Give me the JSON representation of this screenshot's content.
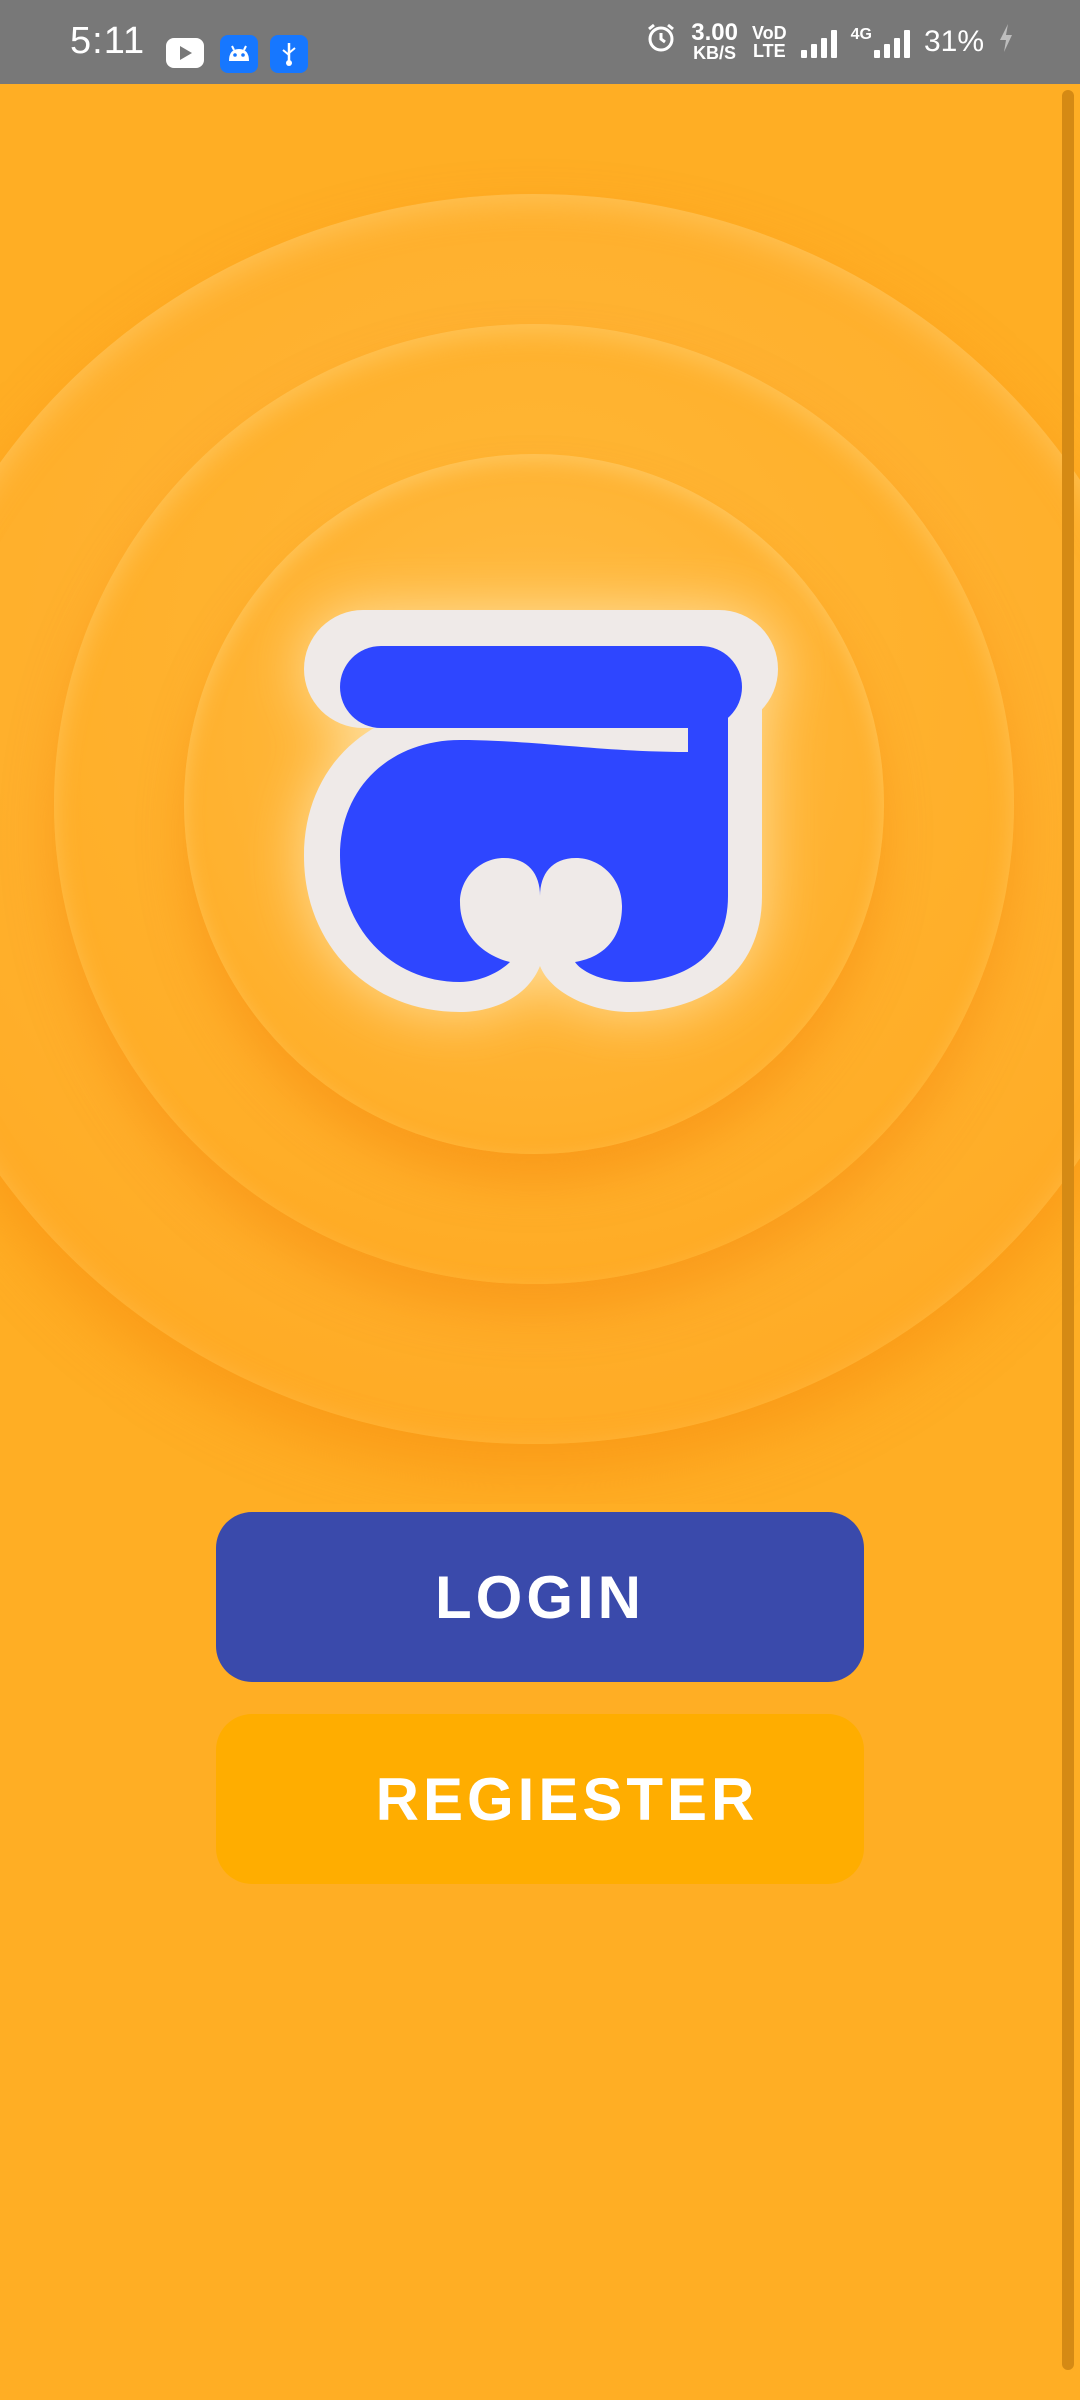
{
  "status_bar": {
    "time": "5:11",
    "speed_value": "3.00",
    "speed_unit": "KB/S",
    "volte_top": "VoD",
    "volte_bottom": "LTE",
    "network_type": "4G",
    "battery": "31%",
    "icons": [
      "youtube-icon",
      "android-icon",
      "usb-icon",
      "alarm-icon",
      "signal-icon",
      "battery-charging-icon"
    ]
  },
  "logo": {
    "icon": "app-logo-icon",
    "colors": {
      "glyph": "#2E46FF",
      "outline": "#EFEAE8"
    }
  },
  "actions": {
    "login_label": "LOGIN",
    "register_label": "REGIESTER"
  },
  "colors": {
    "background": "#FFAE24",
    "login_button": "#3A4AAB",
    "register_button": "#FFAD00",
    "status_bar": "#787878"
  }
}
